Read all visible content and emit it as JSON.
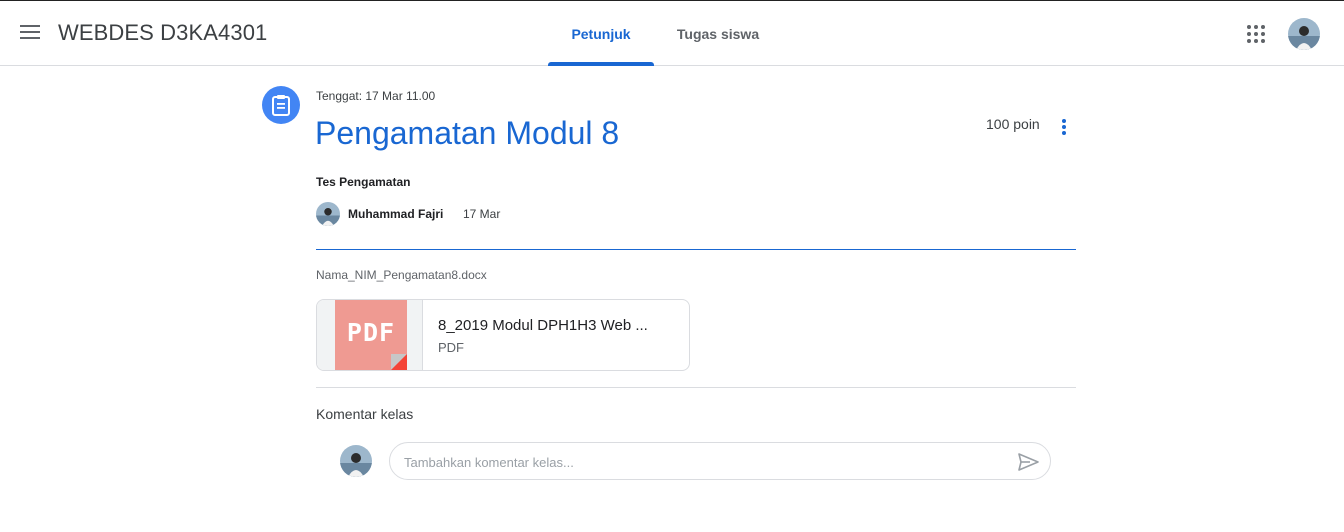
{
  "header": {
    "class_title": "WEBDES D3KA4301",
    "tabs": [
      {
        "label": "Petunjuk",
        "active": true
      },
      {
        "label": "Tugas siswa",
        "active": false
      }
    ],
    "icons": [
      "menu-icon",
      "apps-grid-icon",
      "avatar"
    ]
  },
  "assignment": {
    "icon": "assignment-icon",
    "due": "Tenggat: 17 Mar 11.00",
    "title": "Pengamatan Modul 8",
    "points": "100 poin",
    "description": "Tes Pengamatan",
    "author": "Muhammad Fajri",
    "posted_date": "17 Mar",
    "instruction_filename": "Nama_NIM_Pengamatan8.docx",
    "attachment": {
      "name": "8_2019 Modul DPH1H3 Web ...",
      "type": "PDF",
      "thumb_label": "PDF"
    }
  },
  "comments": {
    "heading": "Komentar kelas",
    "placeholder": "Tambahkan komentar kelas..."
  },
  "colors": {
    "accent": "#1967d2",
    "assignment_icon_bg": "#4285f4",
    "pdf_thumb": "#ef9a92",
    "pdf_corner": "#f44336",
    "divider": "#dadce0"
  }
}
